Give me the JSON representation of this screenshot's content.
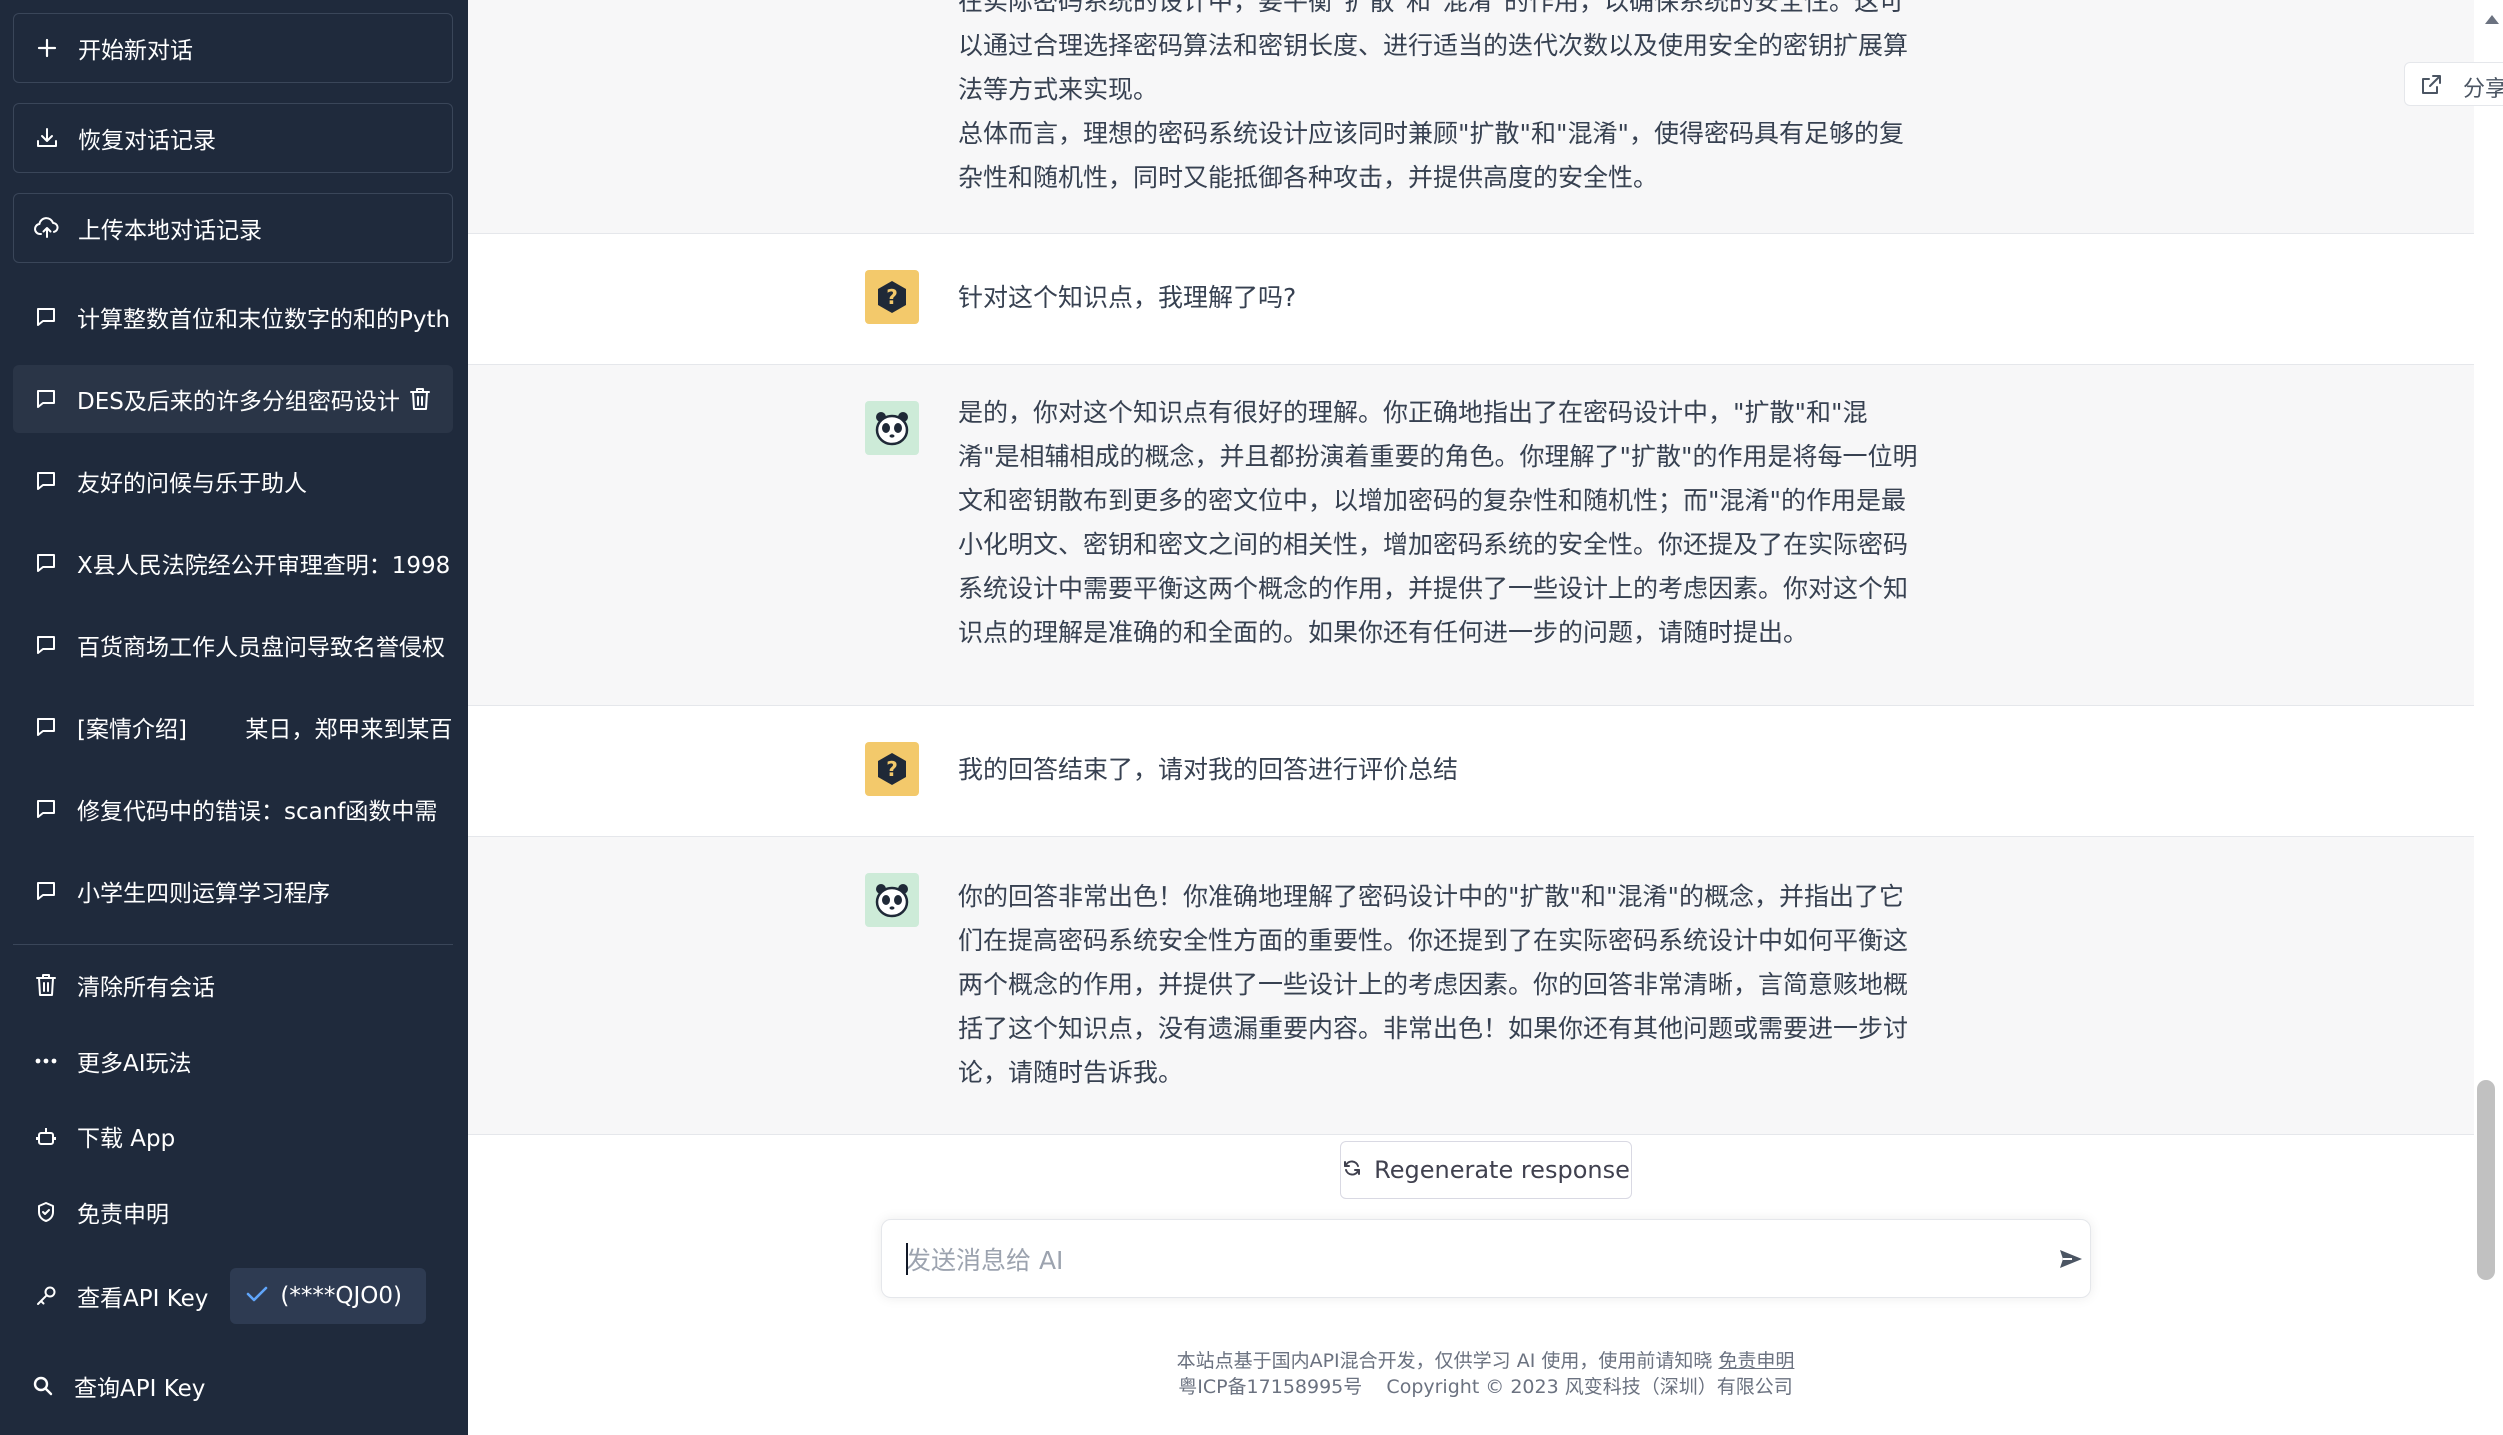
{
  "sidebar": {
    "new_chat": "开始新对话",
    "restore": "恢复对话记录",
    "upload": "上传本地对话记录",
    "conversations": [
      "计算整数首位和末位数字的和的Pyth",
      "DES及后来的许多分组密码设计",
      "友好的问候与乐于助人",
      "X县人民法院经公开审理查明：1998",
      "百货商场工作人员盘问导致名誉侵权",
      "[案情介绍]        某日，郑甲来到某百",
      "修复代码中的错误：scanf函数中需",
      "小学生四则运算学习程序"
    ],
    "clear_all": "清除所有会话",
    "more_ai": "更多AI玩法",
    "download_app": "下载 App",
    "disclaimer": "免责申明",
    "view_api_key": "查看API Key",
    "api_key_value": "(****QJO0)",
    "query_api_key": "查询API Key"
  },
  "header": {
    "share": "分享"
  },
  "messages": {
    "ai_top_line1": "在实际密码系统的设计中，要平衡\"扩散\"和\"混淆\"的作用，以确保系统的安全性。这可",
    "ai_top_line2": "以通过合理选择密码算法和密钥长度、进行适当的迭代次数以及使用安全的密钥扩展算",
    "ai_top_line3": "法等方式来实现。",
    "ai_top_line4": "总体而言，理想的密码系统设计应该同时兼顾\"扩散\"和\"混淆\"，使得密码具有足够的复",
    "ai_top_line5": "杂性和随机性，同时又能抵御各种攻击，并提供高度的安全性。",
    "user_1": "针对这个知识点，我理解了吗?",
    "ai_2": "是的，你对这个知识点有很好的理解。你正确地指出了在密码设计中，\"扩散\"和\"混淆\"是相辅相成的概念，并且都扮演着重要的角色。你理解了\"扩散\"的作用是将每一位明文和密钥散布到更多的密文位中，以增加密码的复杂性和随机性；而\"混淆\"的作用是最小化明文、密钥和密文之间的相关性，增加密码系统的安全性。你还提及了在实际密码系统设计中需要平衡这两个概念的作用，并提供了一些设计上的考虑因素。你对这个知识点的理解是准确的和全面的。如果你还有任何进一步的问题，请随时提出。",
    "user_2": "我的回答结束了，请对我的回答进行评价总结",
    "ai_3": "你的回答非常出色！你准确地理解了密码设计中的\"扩散\"和\"混淆\"的概念，并指出了它们在提高密码系统安全性方面的重要性。你还提到了在实际密码系统设计中如何平衡这两个概念的作用，并提供了一些设计上的考虑因素。你的回答非常清晰，言简意赅地概括了这个知识点，没有遗漏重要内容。非常出色！如果你还有其他问题或需要进一步讨论，请随时告诉我。"
  },
  "composer": {
    "regenerate": "Regenerate response",
    "placeholder": "发送消息给 AI"
  },
  "footer": {
    "line1_prefix": "本站点基于国内API混合开发，仅供学习 AI 使用，使用前请知晓 ",
    "line1_link": "免责申明",
    "line2": "粤ICP备17158995号    Copyright © 2023 风变科技（深圳）有限公司"
  },
  "colors": {
    "sidebar_bg": "#1f2a3c",
    "user_avatar": "#f3c96b",
    "ai_avatar": "#cdebd8",
    "ai_row_bg": "#f7f7f8"
  }
}
